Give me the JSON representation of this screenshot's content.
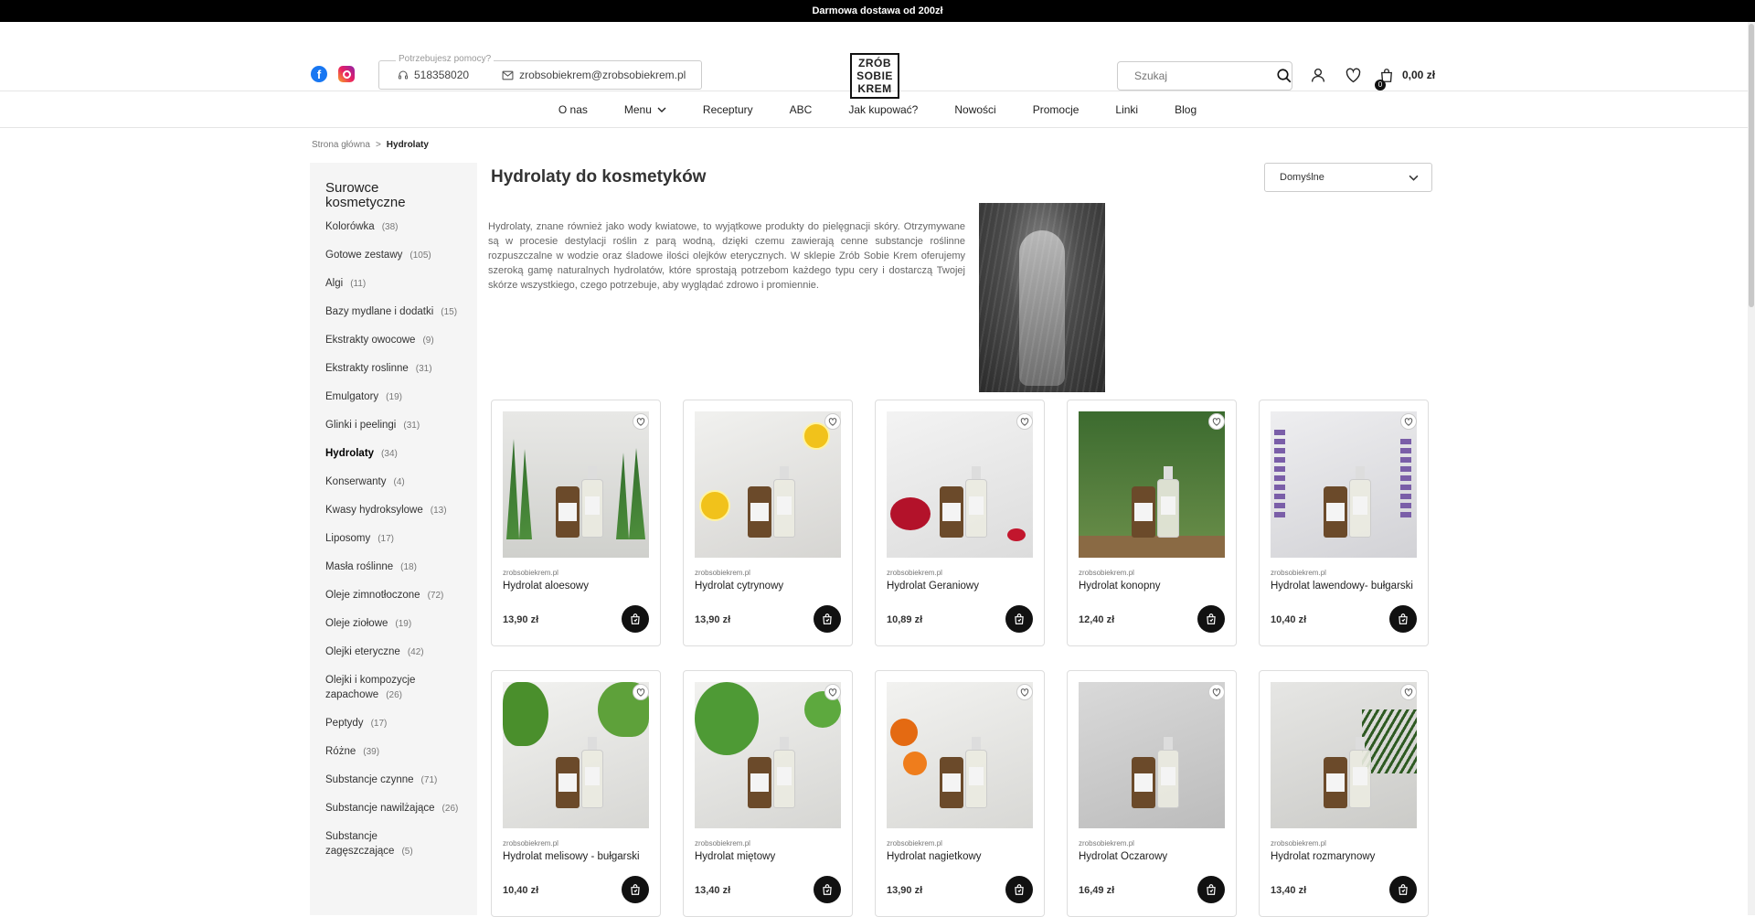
{
  "topbar": {
    "text": "Darmowa dostawa od 200zł"
  },
  "header": {
    "help_label": "Potrzebujesz pomocy?",
    "phone": "518358020",
    "email": "zrobsobiekrem@zrobsobiekrem.pl",
    "logo_lines": [
      "ZRÓB",
      "SOBIE",
      "KREM"
    ],
    "search_placeholder": "Szukaj",
    "cart_count": "0",
    "cart_total": "0,00 zł"
  },
  "nav": {
    "items": [
      "O nas",
      "Menu",
      "Receptury",
      "ABC",
      "Jak kupować?",
      "Nowości",
      "Promocje",
      "Linki",
      "Blog"
    ]
  },
  "breadcrumb": {
    "home": "Strona główna",
    "sep": ">",
    "current": "Hydrolaty"
  },
  "sidebar": {
    "title": "Surowce kosmetyczne",
    "categories": [
      {
        "label": "Kolorówka",
        "count": "(38)"
      },
      {
        "label": "Gotowe zestawy",
        "count": "(105)"
      },
      {
        "label": "Algi",
        "count": "(11)"
      },
      {
        "label": "Bazy mydlane i dodatki",
        "count": "(15)"
      },
      {
        "label": "Ekstrakty owocowe",
        "count": "(9)"
      },
      {
        "label": "Ekstrakty roslinne",
        "count": "(31)"
      },
      {
        "label": "Emulgatory",
        "count": "(19)"
      },
      {
        "label": "Glinki i peelingi",
        "count": "(31)"
      },
      {
        "label": "Hydrolaty",
        "count": "(34)"
      },
      {
        "label": "Konserwanty",
        "count": "(4)"
      },
      {
        "label": "Kwasy hydroksylowe",
        "count": "(13)"
      },
      {
        "label": "Liposomy",
        "count": "(17)"
      },
      {
        "label": "Masła roślinne",
        "count": "(18)"
      },
      {
        "label": "Oleje zimnotłoczone",
        "count": "(72)"
      },
      {
        "label": "Oleje ziołowe",
        "count": "(19)"
      },
      {
        "label": "Olejki eteryczne",
        "count": "(42)"
      },
      {
        "label": "Olejki i kompozycje zapachowe",
        "count": "(26)"
      },
      {
        "label": "Peptydy",
        "count": "(17)"
      },
      {
        "label": "Różne",
        "count": "(39)"
      },
      {
        "label": "Substancje czynne",
        "count": "(71)"
      },
      {
        "label": "Substancje nawilżające",
        "count": "(26)"
      },
      {
        "label": "Substancje zagęszczające",
        "count": "(5)"
      }
    ]
  },
  "main": {
    "title": "Hydrolaty do kosmetyków",
    "sort_value": "Domyślne",
    "description": "Hydrolaty, znane również jako wody kwiatowe, to wyjątkowe produkty do pielęgnacji skóry. Otrzymywane są w procesie destylacji roślin z parą wodną, dzięki czemu zawierają cenne substancje roślinne rozpuszczalne w wodzie oraz śladowe ilości olejków eterycznych. W sklepie Zrób Sobie Krem oferujemy szeroką gamę naturalnych hydrolatów, które sprostają potrzebom każdego typu cery i dostarczą Twojej skórze wszystkiego, czego potrzebuje, aby wyglądać zdrowo i promiennie."
  },
  "products": [
    {
      "brand": "zrobsobiekrem.pl",
      "name": "Hydrolat aloesowy",
      "price": "13,90 zł",
      "scene": "aloe"
    },
    {
      "brand": "zrobsobiekrem.pl",
      "name": "Hydrolat cytrynowy",
      "price": "13,90 zł",
      "scene": "lemon"
    },
    {
      "brand": "zrobsobiekrem.pl",
      "name": "Hydrolat Geraniowy",
      "price": "10,89 zł",
      "scene": "geranium"
    },
    {
      "brand": "zrobsobiekrem.pl",
      "name": "Hydrolat konopny",
      "price": "12,40 zł",
      "scene": "hemp"
    },
    {
      "brand": "zrobsobiekrem.pl",
      "name": "Hydrolat lawendowy- bułgarski",
      "price": "10,40 zł",
      "scene": "lavender"
    },
    {
      "brand": "zrobsobiekrem.pl",
      "name": "Hydrolat melisowy - bułgarski",
      "price": "10,40 zł",
      "scene": "melissa"
    },
    {
      "brand": "zrobsobiekrem.pl",
      "name": "Hydrolat miętowy",
      "price": "13,40 zł",
      "scene": "mint"
    },
    {
      "brand": "zrobsobiekrem.pl",
      "name": "Hydrolat nagietkowy",
      "price": "13,90 zł",
      "scene": "calendula"
    },
    {
      "brand": "zrobsobiekrem.pl",
      "name": "Hydrolat Oczarowy",
      "price": "16,49 zł",
      "scene": "witchhazel"
    },
    {
      "brand": "zrobsobiekrem.pl",
      "name": "Hydrolat rozmarynowy",
      "price": "13,40 zł",
      "scene": "rosemary"
    }
  ]
}
